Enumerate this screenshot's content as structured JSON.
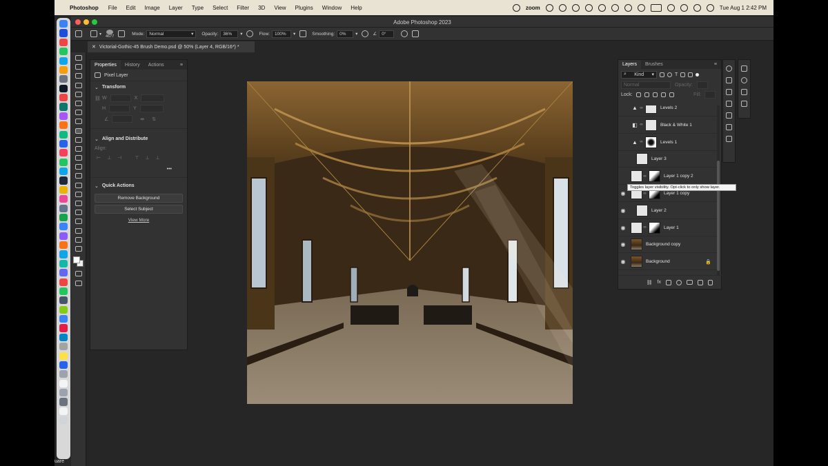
{
  "menubar": {
    "app": "Photoshop",
    "items": [
      "File",
      "Edit",
      "Image",
      "Layer",
      "Type",
      "Select",
      "Filter",
      "3D",
      "View",
      "Plugins",
      "Window",
      "Help"
    ],
    "zoom_label": "zoom",
    "clock": "Tue Aug 1  2:42 PM"
  },
  "window": {
    "title": "Adobe Photoshop 2023"
  },
  "options": {
    "brush_size": "4677",
    "mode_label": "Mode:",
    "mode_value": "Normal",
    "opacity_label": "Opacity:",
    "opacity_value": "36%",
    "flow_label": "Flow:",
    "flow_value": "100%",
    "smoothing_label": "Smoothing:",
    "smoothing_value": "0%",
    "angle_value": "0°"
  },
  "document": {
    "tab_title": "Victorial-Gothic-45 Brush Demo.psd @ 50% (Layer 4, RGB/16*) *"
  },
  "properties": {
    "tabs": [
      "Properties",
      "History",
      "Actions"
    ],
    "layer_type": "Pixel Layer",
    "transform_label": "Transform",
    "align_label": "Align and Distribute",
    "align_sub": "Align:",
    "quick_actions_label": "Quick Actions",
    "remove_bg": "Remove Background",
    "select_subject": "Select Subject",
    "view_more": "View More"
  },
  "layers_panel": {
    "tabs": [
      "Layers",
      "Brushes"
    ],
    "kind": "Kind",
    "blend": "Normal",
    "opacity_label": "Opacity:",
    "lock_label": "Lock:",
    "fill_label": "Fill:",
    "layers": [
      {
        "name": "Levels 2",
        "type": "adjustment",
        "visible": false
      },
      {
        "name": "Black & White 1",
        "type": "adjustment",
        "visible": false
      },
      {
        "name": "Levels 1",
        "type": "adjustment",
        "visible": false
      },
      {
        "name": "Layer 3",
        "type": "pixel",
        "visible": false
      },
      {
        "name": "Layer 1 copy 2",
        "type": "masked",
        "visible": false
      },
      {
        "name": "Layer 1 copy",
        "type": "masked",
        "visible": true
      },
      {
        "name": "Layer 2",
        "type": "pixel",
        "visible": true
      },
      {
        "name": "Layer 1",
        "type": "masked",
        "visible": true
      },
      {
        "name": "Background copy",
        "type": "photo",
        "visible": true
      },
      {
        "name": "Background",
        "type": "photo",
        "visible": true
      }
    ],
    "tooltip": "Toggles layer visibility. Opt-click to only show layer."
  },
  "dock_label": "uare",
  "colors": {
    "menubar": "#e9e3d3",
    "panel": "#323232",
    "workspace": "#262626"
  }
}
